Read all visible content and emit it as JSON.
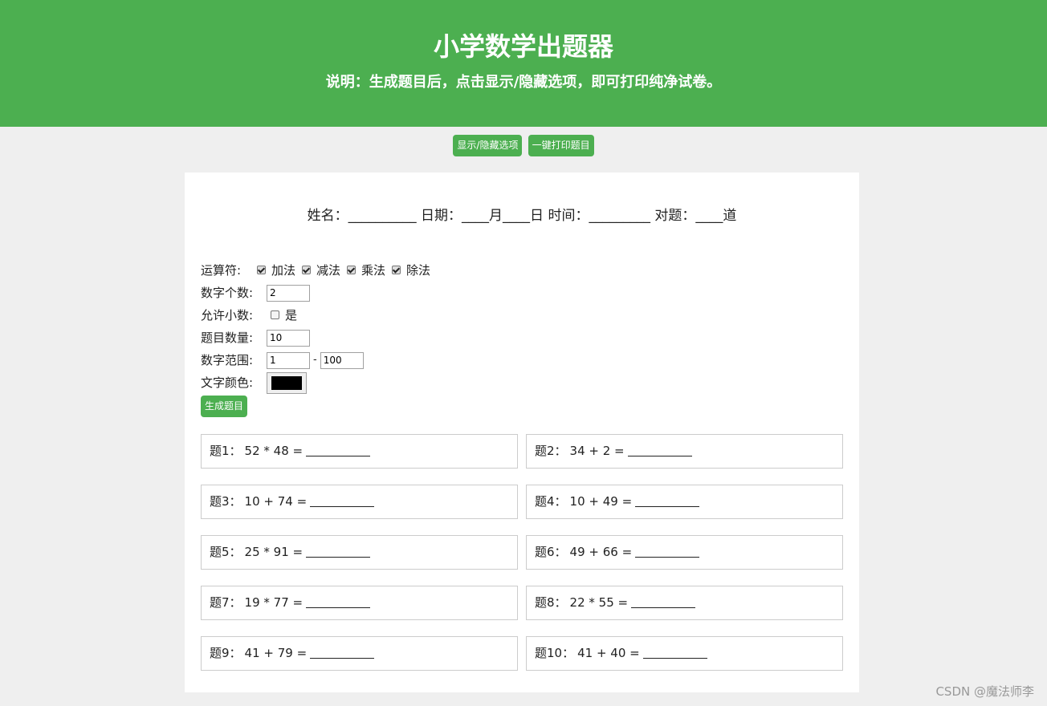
{
  "header": {
    "title": "小学数学出题器",
    "note": "说明：生成题目后，点击显示/隐藏选项，即可打印纯净试卷。"
  },
  "toolbar": {
    "toggle_label": "显示/隐藏选项",
    "print_label": "一键打印题目"
  },
  "info_line": "姓名：__________ 日期：____月____日 时间：_________ 对题：____道",
  "options": {
    "operators_label": "运算符:",
    "operators": [
      {
        "label": "加法",
        "checked": true
      },
      {
        "label": "减法",
        "checked": true
      },
      {
        "label": "乘法",
        "checked": true
      },
      {
        "label": "除法",
        "checked": true
      }
    ],
    "number_count_label": "数字个数:",
    "number_count": "2",
    "decimal_label": "允许小数:",
    "decimal_option": "是",
    "decimal_checked": false,
    "question_count_label": "题目数量:",
    "question_count": "10",
    "range_label": "数字范围:",
    "range_min": "1",
    "range_sep": "-",
    "range_max": "100",
    "color_label": "文字颜色:",
    "color_value": "#000000",
    "generate_label": "生成题目"
  },
  "questions": [
    {
      "label": "题1：",
      "expr": "52 * 48 ="
    },
    {
      "label": "题2：",
      "expr": "34 + 2 ="
    },
    {
      "label": "题3：",
      "expr": "10 + 74 ="
    },
    {
      "label": "题4：",
      "expr": "10 + 49 ="
    },
    {
      "label": "题5：",
      "expr": "25 * 91 ="
    },
    {
      "label": "题6：",
      "expr": "49 + 66 ="
    },
    {
      "label": "题7：",
      "expr": "19 * 77 ="
    },
    {
      "label": "题8：",
      "expr": "22 * 55 ="
    },
    {
      "label": "题9：",
      "expr": "41 + 79 ="
    },
    {
      "label": "题10：",
      "expr": "41 + 40 ="
    }
  ],
  "watermark": "CSDN @魔法师李",
  "colors": {
    "accent": "#4caf50",
    "background": "#efefef"
  }
}
